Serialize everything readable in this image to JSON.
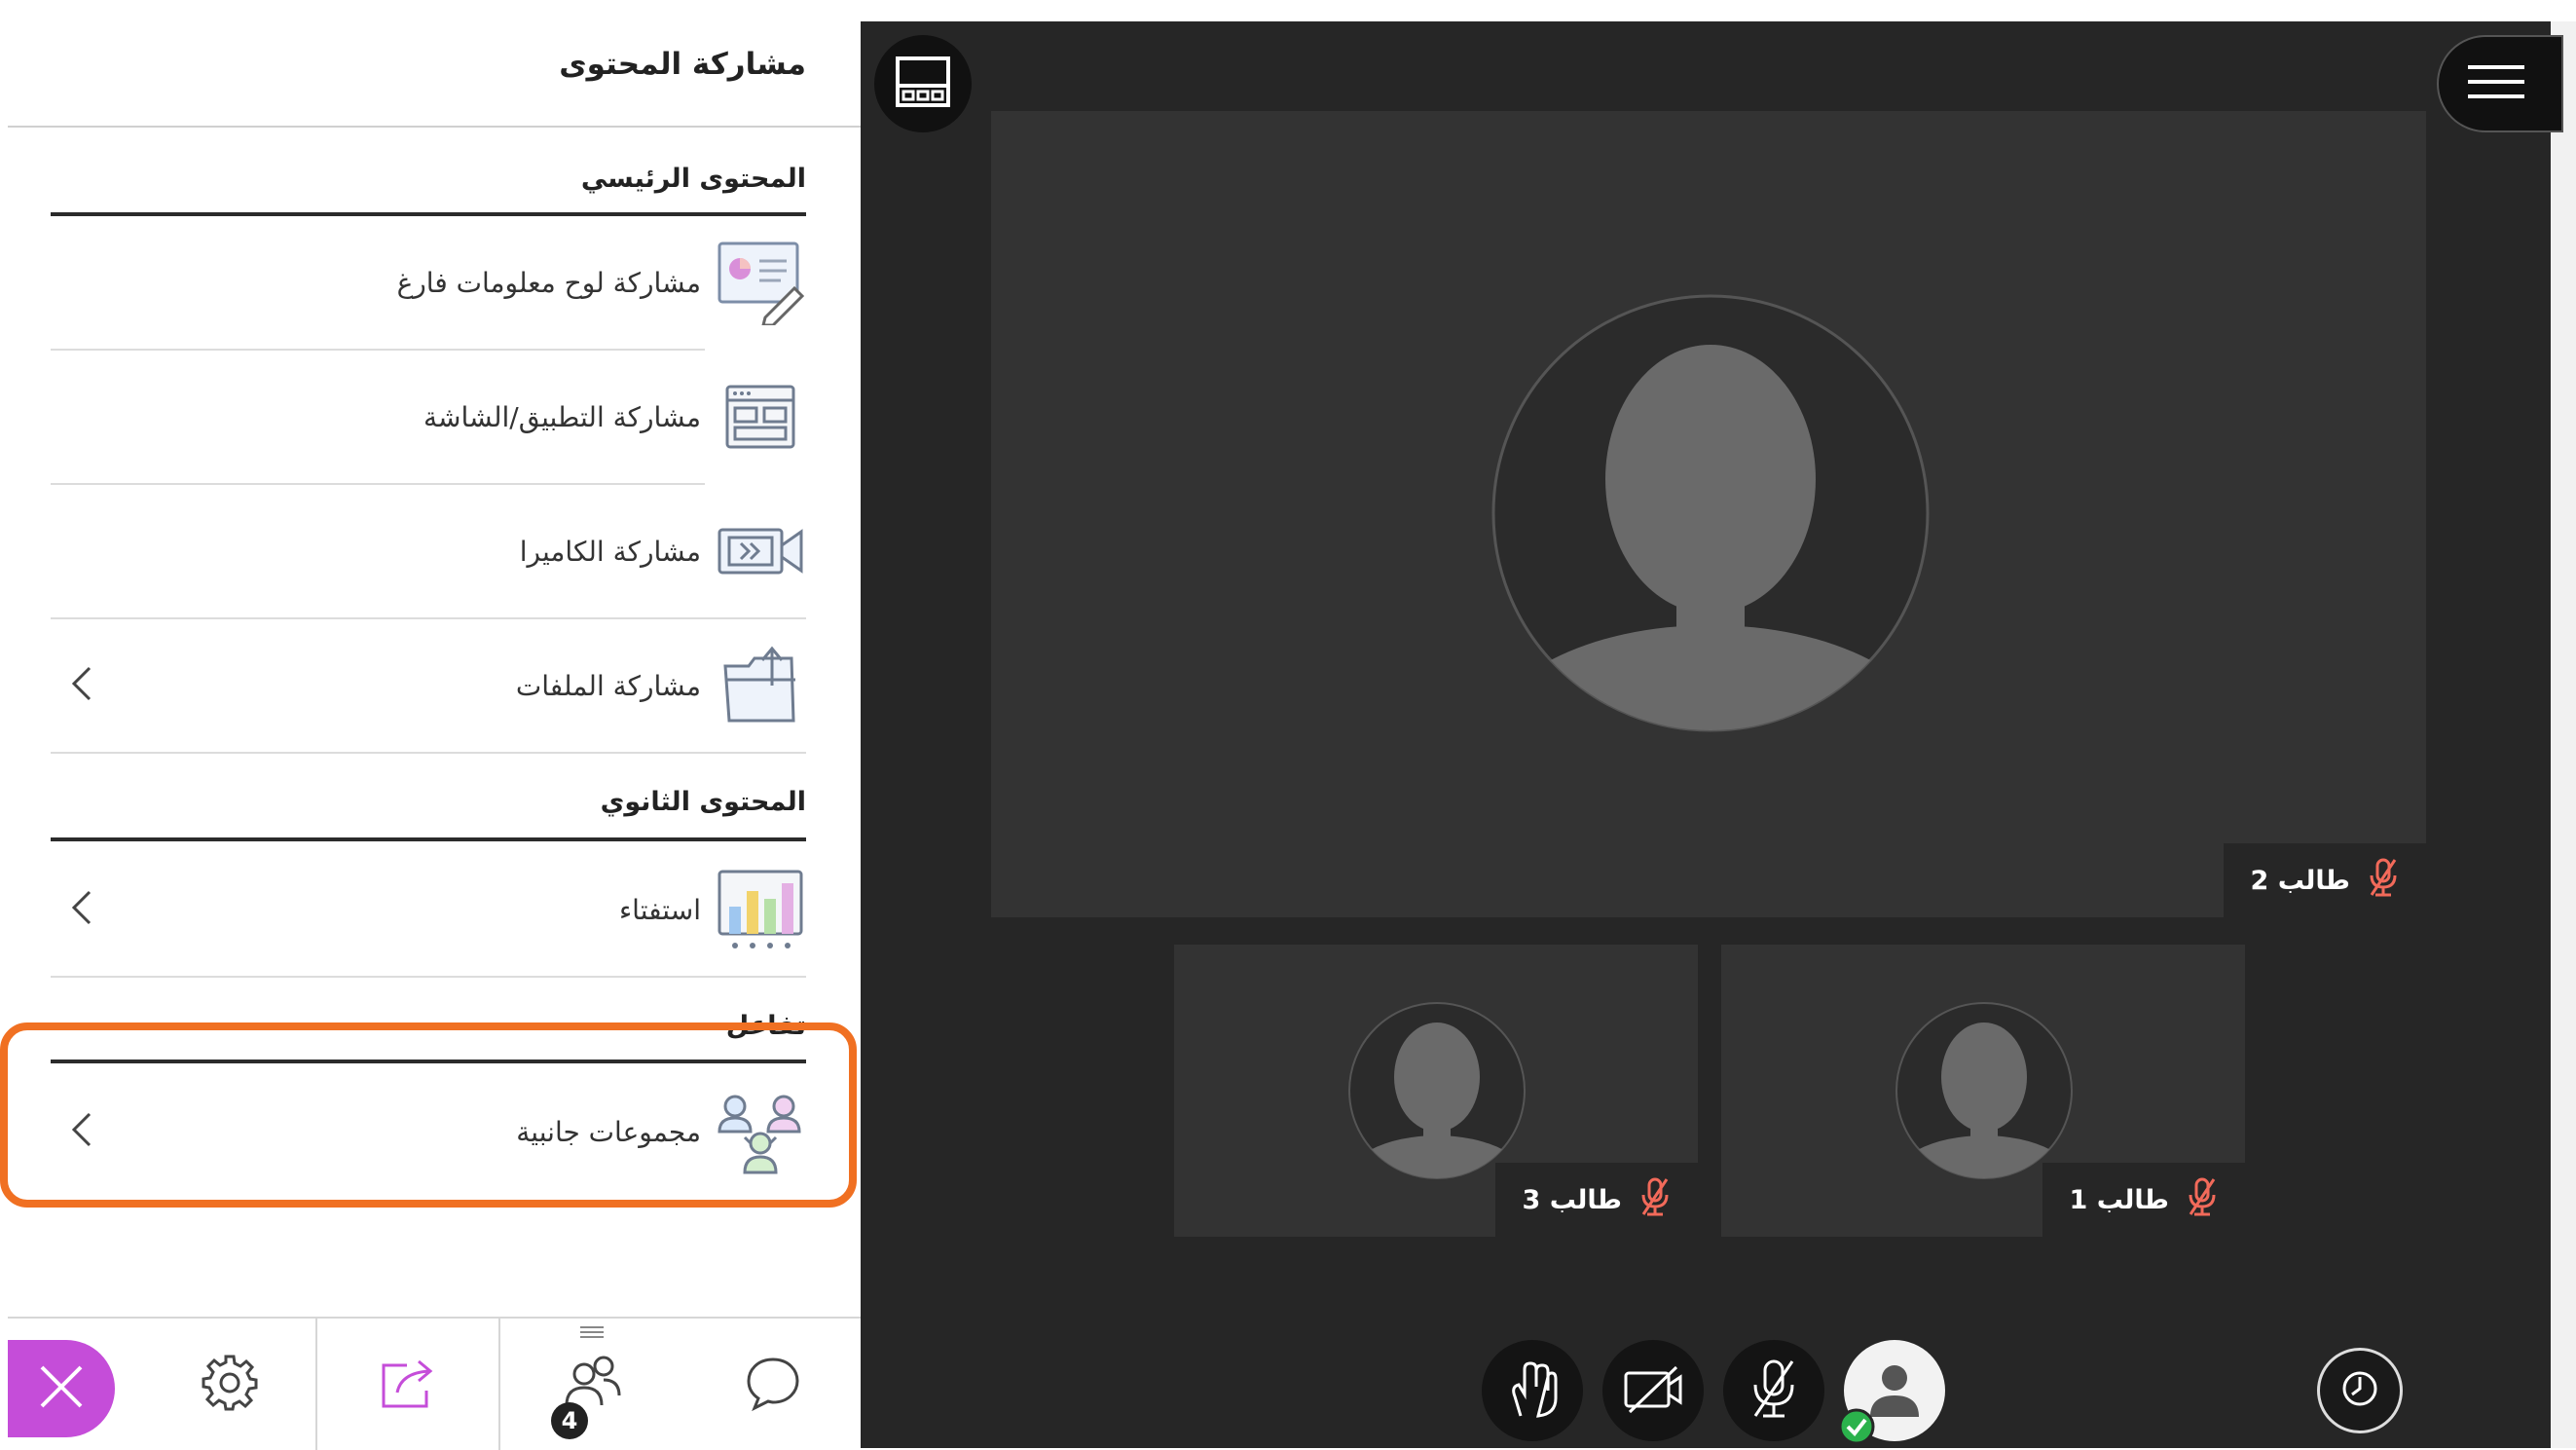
{
  "panel": {
    "title": "مشاركة المحتوى",
    "primary": {
      "heading": "المحتوى الرئيسي",
      "items": [
        {
          "label": "مشاركة لوح معلومات فارغ",
          "icon": "whiteboard-icon"
        },
        {
          "label": "مشاركة التطبيق/الشاشة",
          "icon": "screen-share-icon"
        },
        {
          "label": "مشاركة الكاميرا",
          "icon": "camera-icon"
        },
        {
          "label": "مشاركة الملفات",
          "icon": "folder-upload-icon"
        }
      ]
    },
    "secondary": {
      "heading": "المحتوى الثانوي",
      "items": [
        {
          "label": "استفتاء",
          "icon": "poll-chart-icon"
        }
      ]
    },
    "interaction": {
      "heading": "تفاعل",
      "items": [
        {
          "label": "مجموعات جانبية",
          "icon": "breakout-groups-icon"
        }
      ]
    },
    "highlight_color": "#f07022"
  },
  "tabbar": {
    "close_color": "#c54dd9",
    "tabs": [
      {
        "name": "close",
        "icon": "close-icon"
      },
      {
        "name": "settings",
        "icon": "gear-icon"
      },
      {
        "name": "share-content",
        "icon": "share-icon",
        "active": true
      },
      {
        "name": "participants",
        "icon": "participants-icon",
        "badge": "4"
      },
      {
        "name": "chat",
        "icon": "chat-icon"
      }
    ]
  },
  "stage": {
    "main_participant": {
      "name": "طالب 2",
      "muted": true
    },
    "thumbnails": [
      {
        "name": "طالب 3",
        "muted": true
      },
      {
        "name": "طالب 1",
        "muted": true
      }
    ],
    "controls": [
      {
        "name": "raise-hand",
        "icon": "raise-hand-icon"
      },
      {
        "name": "camera-off",
        "icon": "camera-off-icon"
      },
      {
        "name": "mic-off",
        "icon": "mic-off-icon"
      },
      {
        "name": "my-status",
        "icon": "avatar-icon"
      }
    ],
    "muted_color": "#f26a5a",
    "status_color": "#2bb24c"
  }
}
